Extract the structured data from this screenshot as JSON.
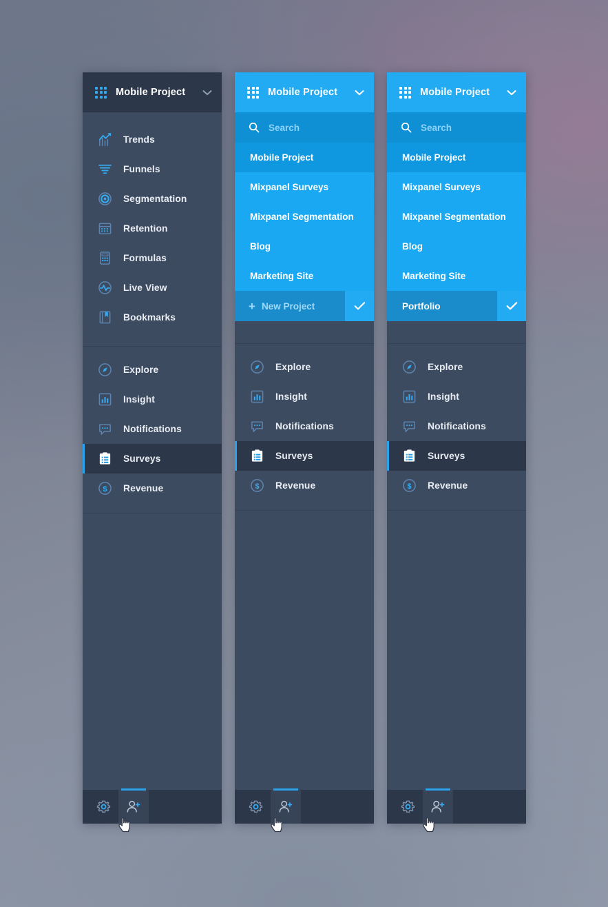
{
  "app": {
    "project_name": "Mobile Project",
    "grid_icon": "grid-icon",
    "chevron_icon": "chevron-down-icon"
  },
  "dropdown": {
    "search_placeholder": "Search",
    "search_icon": "search-icon",
    "projects": [
      {
        "label": "Mobile Project",
        "selected": true
      },
      {
        "label": "Mixpanel Surveys",
        "selected": false
      },
      {
        "label": "Mixpanel Segmentation",
        "selected": false
      },
      {
        "label": "Blog",
        "selected": false
      },
      {
        "label": "Marketing Site",
        "selected": false
      }
    ],
    "new_project_label": "New Project",
    "new_project_value": "Portfolio",
    "plus_icon": "plus-icon",
    "confirm_icon": "check-icon"
  },
  "nav": {
    "primary": [
      {
        "label": "Trends",
        "icon": "trends-chart-icon"
      },
      {
        "label": "Funnels",
        "icon": "funnel-icon"
      },
      {
        "label": "Segmentation",
        "icon": "target-icon"
      },
      {
        "label": "Retention",
        "icon": "calendar-icon"
      },
      {
        "label": "Formulas",
        "icon": "calculator-icon"
      },
      {
        "label": "Live View",
        "icon": "pulse-circle-icon"
      },
      {
        "label": "Bookmarks",
        "icon": "bookmark-icon"
      }
    ],
    "secondary": [
      {
        "label": "Explore",
        "icon": "compass-icon",
        "active": false
      },
      {
        "label": "Insight",
        "icon": "bar-chart-icon",
        "active": false
      },
      {
        "label": "Notifications",
        "icon": "speech-bubble-icon",
        "active": false
      },
      {
        "label": "Surveys",
        "icon": "clipboard-icon",
        "active": true
      },
      {
        "label": "Revenue",
        "icon": "dollar-circle-icon",
        "active": false
      }
    ]
  },
  "bottom_bar": {
    "settings_icon": "gear-icon",
    "add_user_icon": "add-user-icon"
  },
  "colors": {
    "accent_blue": "#29a3ee",
    "header_blue": "#22aaf3",
    "dropdown_blue": "#1aa8f2",
    "dropdown_selected": "#0f97e0",
    "sidebar_bg": "#3d4b60",
    "header_dark": "#2c3749"
  }
}
